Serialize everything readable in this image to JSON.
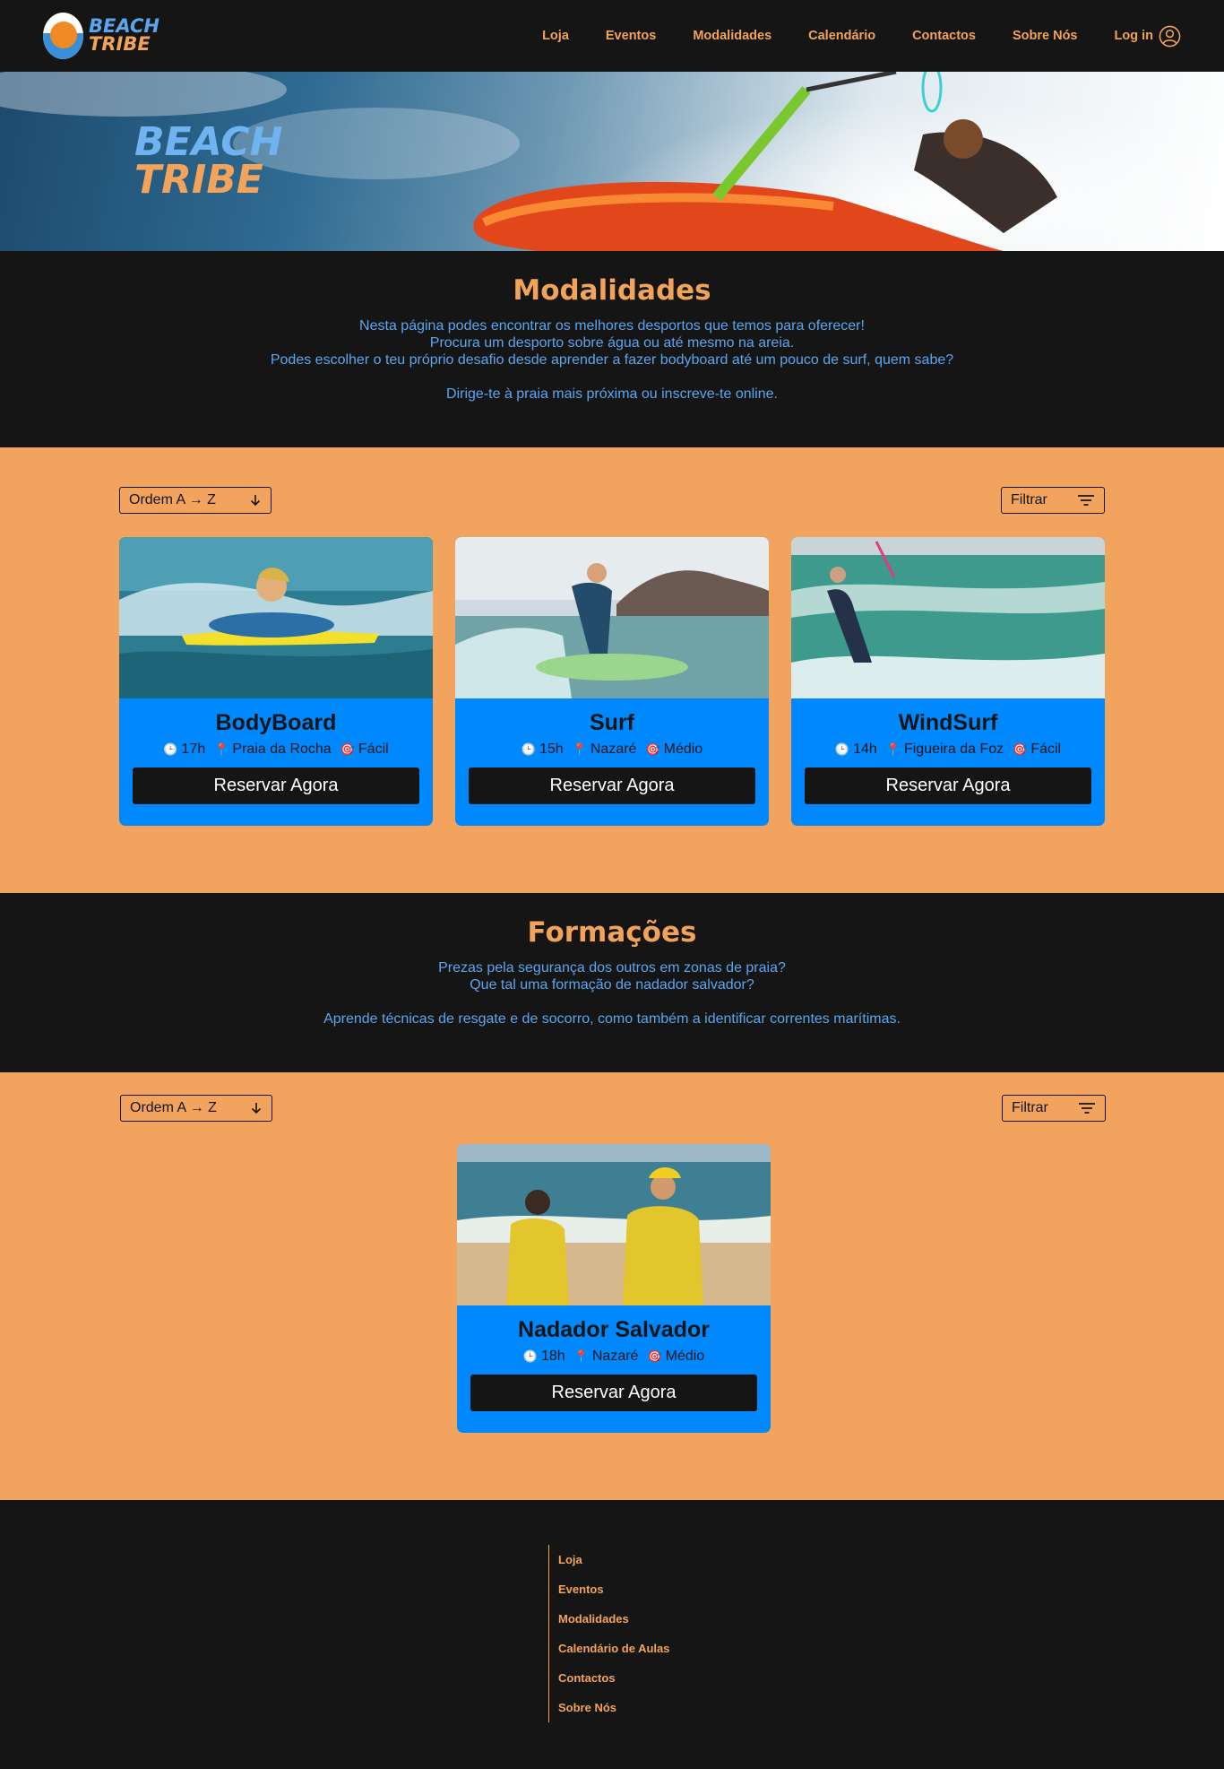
{
  "brand": {
    "line1": "BEACH",
    "line2": "TRIBE"
  },
  "nav": {
    "items": [
      "Loja",
      "Eventos",
      "Modalidades",
      "Calendário",
      "Contactos",
      "Sobre Nós"
    ],
    "login": "Log in"
  },
  "hero": {
    "line1": "BEACH",
    "line2": "TRIBE"
  },
  "modalidades": {
    "title": "Modalidades",
    "lines": [
      "Nesta página podes encontrar os melhores desportos que temos para oferecer!",
      "Procura um desporto sobre água ou até mesmo na areia.",
      "Podes escolher o teu próprio desafio desde aprender a fazer bodyboard até um pouco de surf, quem sabe?"
    ],
    "extra": "Dirige-te à praia mais próxima ou inscreve-te online."
  },
  "controls": {
    "sort_label": "Ordem A → Z",
    "filter_label": "Filtrar"
  },
  "cards_sports": [
    {
      "title": "BodyBoard",
      "time": "17h",
      "place": "Praia da Rocha",
      "level": "Fácil",
      "button": "Reservar Agora"
    },
    {
      "title": "Surf",
      "time": "15h",
      "place": "Nazaré",
      "level": "Médio",
      "button": "Reservar Agora"
    },
    {
      "title": "WindSurf",
      "time": "14h",
      "place": "Figueira da Foz",
      "level": "Fácil",
      "button": "Reservar Agora"
    }
  ],
  "formacoes": {
    "title": "Formações",
    "lines": [
      "Prezas pela segurança dos outros em zonas de praia?",
      "Que tal uma formação de nadador salvador?"
    ],
    "extra": "Aprende técnicas de resgate e de socorro, como também a identificar correntes marítimas."
  },
  "cards_training": [
    {
      "title": "Nadador Salvador",
      "time": "18h",
      "place": "Nazaré",
      "level": "Médio",
      "button": "Reservar Agora"
    }
  ],
  "footer": {
    "links": [
      "Loja",
      "Eventos",
      "Modalidades",
      "Calendário de Aulas",
      "Contactos",
      "Sobre Nós"
    ]
  },
  "colors": {
    "dark": "#151515",
    "orange": "#f2a35a",
    "band": "#f2a35e",
    "blue": "#0088ff",
    "text_blue": "#5aa6ee"
  },
  "icons": {
    "clock": "clock-icon",
    "pin": "pin-icon",
    "level": "target-icon",
    "sort": "arrow-down-icon",
    "filter": "filter-lines-icon",
    "user": "user-icon"
  }
}
